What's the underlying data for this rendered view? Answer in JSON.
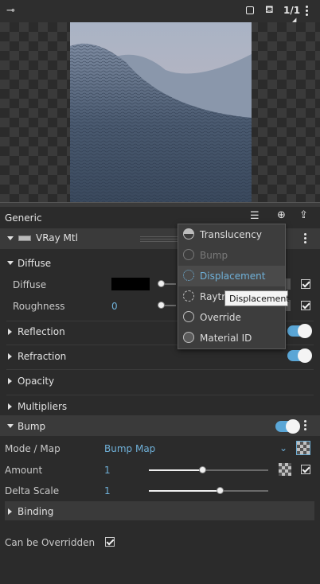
{
  "toolbar": {
    "ratio": "1/1"
  },
  "panel": {
    "title": "Generic",
    "material_name": "VRay Mtl",
    "diffuse_section": "Diffuse",
    "diffuse_label": "Diffuse",
    "roughness_label": "Roughness",
    "roughness_value": "0",
    "reflection": "Reflection",
    "refraction": "Refraction",
    "opacity": "Opacity",
    "multipliers": "Multipliers",
    "bump": "Bump",
    "mode_map_label": "Mode / Map",
    "mode_map_value": "Bump Map",
    "amount_label": "Amount",
    "amount_value": "1",
    "delta_scale_label": "Delta Scale",
    "delta_scale_value": "1",
    "binding": "Binding",
    "can_be_overridden": "Can be Overridden"
  },
  "menu": {
    "items": [
      {
        "label": "Translucency",
        "state": "enabled"
      },
      {
        "label": "Bump",
        "state": "disabled"
      },
      {
        "label": "Displacement",
        "state": "highlighted"
      },
      {
        "label": "Raytrace",
        "state": "enabled"
      },
      {
        "label": "Override",
        "state": "enabled"
      },
      {
        "label": "Material ID",
        "state": "enabled"
      }
    ]
  },
  "tooltip": "Displacement",
  "sliders": {
    "amount": 0.45,
    "delta_scale": 0.6
  },
  "colors": {
    "accent": "#5aa6d6",
    "label_blue": "#6fb0d8",
    "diffuse_swatch": "#000000"
  }
}
